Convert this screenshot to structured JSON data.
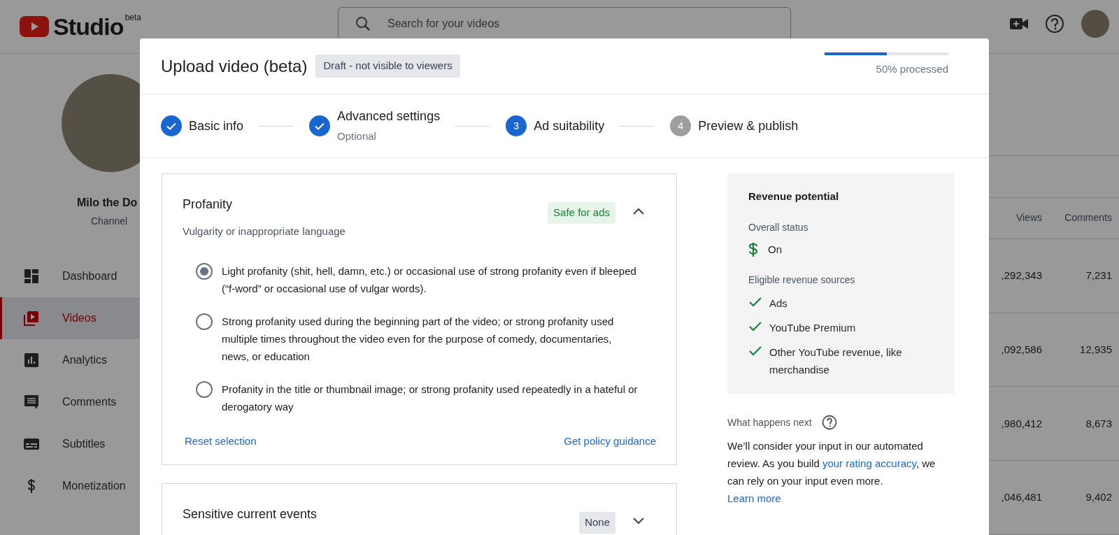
{
  "app_bar": {
    "logo_text": "Studio",
    "logo_badge": "beta",
    "search": {
      "placeholder": "Search for your videos"
    }
  },
  "channel": {
    "name": "Milo the Do",
    "subtitle": "Channel"
  },
  "sidebar": {
    "items": [
      {
        "kind": "dashboard",
        "label": "Dashboard",
        "selected": false
      },
      {
        "kind": "videos",
        "label": "Videos",
        "selected": true
      },
      {
        "kind": "analytics",
        "label": "Analytics",
        "selected": false
      },
      {
        "kind": "comments",
        "label": "Comments",
        "selected": false
      },
      {
        "kind": "subtitles",
        "label": "Subtitles",
        "selected": false
      },
      {
        "kind": "monetization",
        "label": "Monetization",
        "selected": false
      }
    ]
  },
  "table": {
    "columns": [
      "Views",
      "Comments"
    ],
    "rows": [
      [
        ",292,343",
        "7,231"
      ],
      [
        ",092,586",
        "12,935"
      ],
      [
        ",980,412",
        "8,673"
      ],
      [
        ",046,481",
        "9,402"
      ]
    ]
  },
  "dialog": {
    "title": "Upload video (beta)",
    "status_badge": "Draft - not visible to viewers",
    "progress": {
      "level": 0.5,
      "label": "50% processed"
    },
    "steps": [
      {
        "kind": "done",
        "label": "Basic info"
      },
      {
        "kind": "done",
        "label": "Advanced settings",
        "sublabel": "Optional"
      },
      {
        "kind": "current",
        "number": "3",
        "label": "Ad suitability"
      },
      {
        "kind": "upcoming",
        "number": "4",
        "label": "Preview & publish"
      }
    ],
    "sections": [
      {
        "title": "Profanity",
        "subtitle": "Vulgarity or inappropriate language",
        "rating": "Safe for ads",
        "kind": "safe",
        "expanded": true,
        "options": [
          {
            "text": "Light profanity (shit, hell, damn, etc.) or occasional use of strong profanity even if bleeped (“f-word” or occasional use of vulgar words).",
            "selected": true
          },
          {
            "text": "Strong profanity used during the beginning part of the video; or strong profanity used multiple times throughout the video even for the purpose of comedy, documentaries, news, or education",
            "selected": false
          },
          {
            "text": "Profanity in the title or thumbnail image; or strong profanity used repeatedly in a hateful or derogatory way",
            "selected": false
          }
        ],
        "actions": [
          "Reset selection",
          "Get policy guidance"
        ]
      },
      {
        "title": "Sensitive current events",
        "rating": "None",
        "kind": "none",
        "expanded": false
      }
    ],
    "revenue": {
      "title": "Revenue potential",
      "overall_label": "Overall status",
      "overall_value": "On",
      "sources_label": "Eligible revenue sources",
      "sources": [
        "Ads",
        "YouTube Premium",
        "Other YouTube revenue, like merchandise"
      ]
    },
    "next": {
      "title": "What happens next",
      "parts": [
        {
          "kind": "text",
          "text": "We’ll consider your input in our automated review. As you build "
        },
        {
          "kind": "link",
          "text": "your rating accuracy"
        },
        {
          "kind": "text",
          "text": ", we can rely on your input even more. "
        },
        {
          "kind": "link",
          "text": "Learn more"
        }
      ]
    }
  }
}
